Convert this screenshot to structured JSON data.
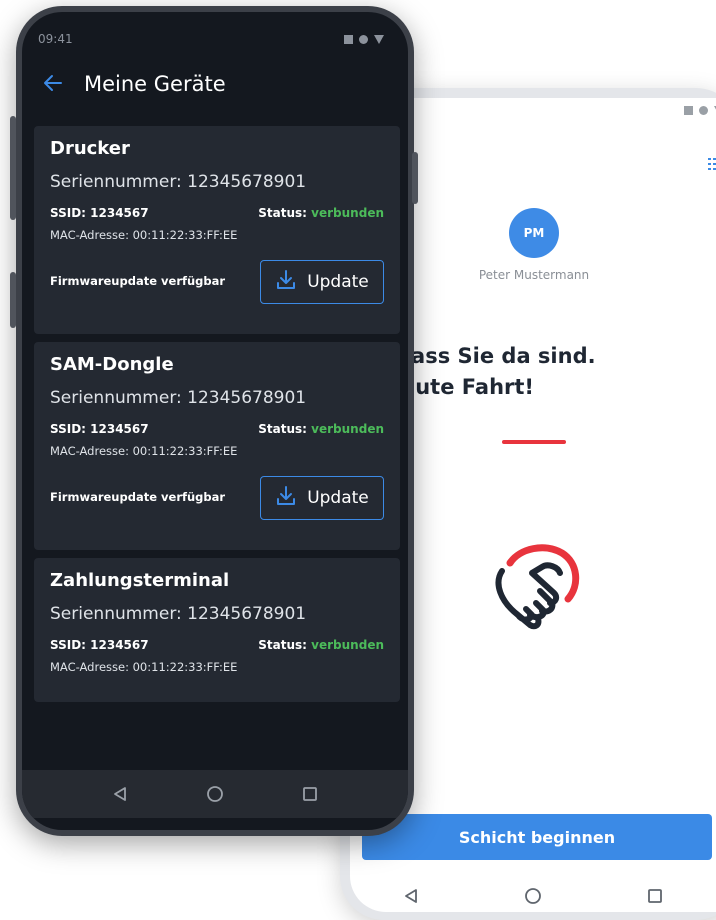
{
  "dark_phone": {
    "status_time": "09:41",
    "title": "Meine Geräte",
    "devices": [
      {
        "name": "Drucker",
        "serial": "Seriennummer: 12345678901",
        "ssid": "SSID: 1234567",
        "status_label": "Status:",
        "status_value": "verbunden",
        "mac": "MAC-Adresse: 00:11:22:33:FF:EE",
        "firmware_text": "Firmwareupdate verfügbar",
        "update_label": "Update"
      },
      {
        "name": "SAM-Dongle",
        "serial": "Seriennummer: 12345678901",
        "ssid": "SSID: 1234567",
        "status_label": "Status:",
        "status_value": "verbunden",
        "mac": "MAC-Adresse: 00:11:22:33:FF:EE",
        "firmware_text": "Firmwareupdate verfügbar",
        "update_label": "Update"
      },
      {
        "name": "Zahlungsterminal",
        "serial": "Seriennummer: 12345678901",
        "ssid": "SSID: 1234567",
        "status_label": "Status:",
        "status_value": "verbunden",
        "mac": "MAC-Adresse: 00:11:22:33:FF:EE"
      }
    ]
  },
  "light_phone": {
    "avatar_initials": "PM",
    "user_name": "Peter Mustermann",
    "greeting_line1": "hön, dass Sie da sind.",
    "greeting_line2": "Gute Fahrt!",
    "start_button": "Schicht beginnen"
  },
  "colors": {
    "accent_blue": "#3b8ae6",
    "status_green": "#4cbb5a",
    "accent_red": "#e8343d",
    "dark_background": "#14181f",
    "card_background": "#242932"
  },
  "icons": [
    "back-arrow-icon",
    "download-icon",
    "list-menu-icon",
    "handshake-icon",
    "nav-back-icon",
    "nav-home-icon",
    "nav-recents-icon"
  ]
}
